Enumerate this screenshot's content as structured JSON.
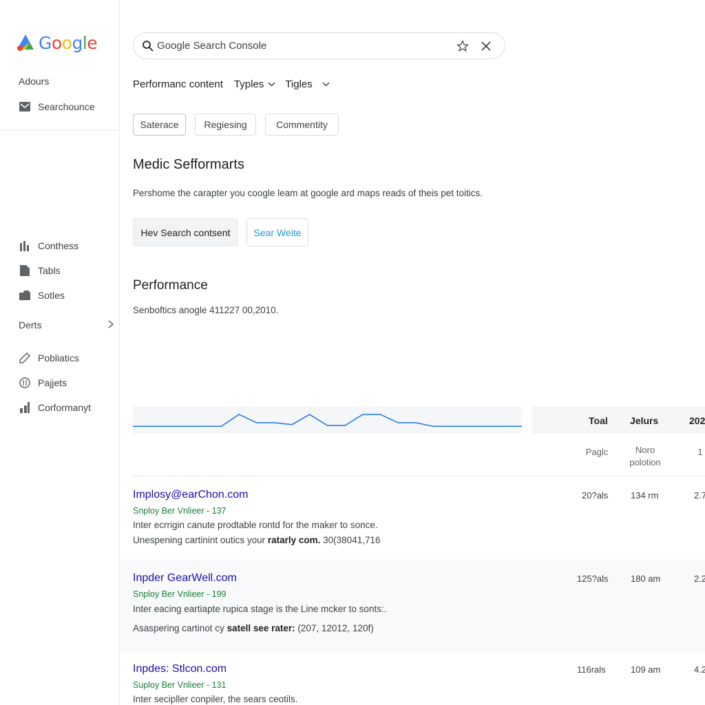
{
  "app": {
    "logo_text": "Google"
  },
  "sidebar": {
    "heading": "Adours",
    "top_item": {
      "label": "Searchounce",
      "icon": "mail-icon"
    },
    "items": [
      {
        "label": "Conthess",
        "icon": "bar-chart-icon"
      },
      {
        "label": "Tabls",
        "icon": "file-icon"
      },
      {
        "label": "Sotles",
        "icon": "folder-icon"
      }
    ],
    "group": {
      "label": "Derts"
    },
    "bottom_items": [
      {
        "label": "Pobliatics",
        "icon": "pencil-icon"
      },
      {
        "label": "Pajjets",
        "icon": "badge-icon"
      },
      {
        "label": "Corformanyt",
        "icon": "stats-icon"
      }
    ]
  },
  "search": {
    "value": "Google Search Console"
  },
  "filters": {
    "title": "Performanc content",
    "dropdown1": "Typles",
    "dropdown2": "Tigles"
  },
  "tabs": [
    "Saterace",
    "Regiesing",
    "Commentity"
  ],
  "section1": {
    "title": "Medic Sefformarts",
    "description": "Pershome the carapter you coogle leam at google ard maps reads of theis pet toitics.",
    "primary_button": "Hev Search contsent",
    "secondary_button": "Sear Weite"
  },
  "section2": {
    "title": "Performance",
    "subtitle": "Senboftics anogle 411227 00,2010."
  },
  "chart_data": {
    "type": "line",
    "series": [
      {
        "values": [
          5,
          5,
          5,
          5,
          5,
          5,
          18,
          9,
          9,
          7,
          18,
          6,
          6,
          18,
          18,
          9,
          9,
          5,
          5,
          5,
          5,
          5,
          5
        ]
      }
    ],
    "color": "#1a73e8"
  },
  "table": {
    "headers": [
      "Toal",
      "Jelurs",
      "202"
    ],
    "subheaders": [
      "Paglc",
      "Noro polotion",
      "1"
    ],
    "rows": [
      {
        "title": "Implosy@earChon.com",
        "url": "Snploy Ber Vnlieer - 137",
        "line1": "Inter ecrrigin canute prodtable rontd for the maker to sonce.",
        "line2_pre": "Unespening cartinint outics your ",
        "line2_bold": "ratarly com.",
        "line2_post": " 30(38041,716",
        "col1": "20?als",
        "col2": "134 rm",
        "col3": "2.7"
      },
      {
        "title": "Inpder GearWell.com",
        "url": "Snploy Ber Vnlieer - 199",
        "line1": "Inter eacing eartiapte rupica stage is the Line mcker to sonts:.",
        "line2_pre": "Asaspering cartinot cy ",
        "line2_bold": "satell see rater:",
        "line2_post": " (207, 12012, 120f)",
        "col1": "125?als",
        "col2": "180 am",
        "col3": "2.2"
      },
      {
        "title": "Inpdes: Stlcon.com",
        "url": "Suploy Ber Vnlieer - 131",
        "line1": "Inter secipller conpiler, the sears ceotils.",
        "line2_pre": "",
        "line2_bold": "",
        "line2_post": "",
        "col1": "116rals",
        "col2": "109 am",
        "col3": "4.2"
      }
    ]
  }
}
